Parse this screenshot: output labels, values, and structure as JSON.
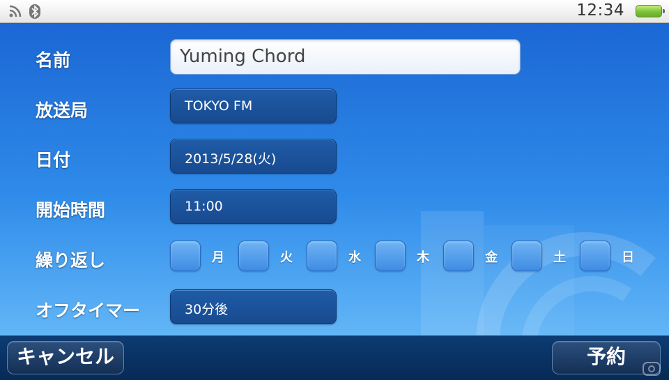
{
  "status_bar": {
    "time": "12:34",
    "icons": [
      "wifi-icon",
      "bluetooth-icon",
      "battery-icon"
    ]
  },
  "form": {
    "name_label": "名前",
    "name_value": "Yuming Chord",
    "station_label": "放送局",
    "station_value": "TOKYO FM",
    "date_label": "日付",
    "date_value": "2013/5/28(火)",
    "start_label": "開始時間",
    "start_value": "11:00",
    "repeat_label": "繰り返し",
    "repeat_days": [
      {
        "label": "月",
        "checked": false
      },
      {
        "label": "火",
        "checked": false
      },
      {
        "label": "水",
        "checked": false
      },
      {
        "label": "木",
        "checked": false
      },
      {
        "label": "金",
        "checked": false
      },
      {
        "label": "土",
        "checked": false
      },
      {
        "label": "日",
        "checked": false
      }
    ],
    "off_timer_label": "オフタイマー",
    "off_timer_value": "30分後"
  },
  "bottom_bar": {
    "cancel_label": "キャンセル",
    "reserve_label": "予約"
  },
  "colors": {
    "accent": "#1e72d6",
    "field_dark": "#1d57a2",
    "bottom_bar": "#0a3364"
  }
}
